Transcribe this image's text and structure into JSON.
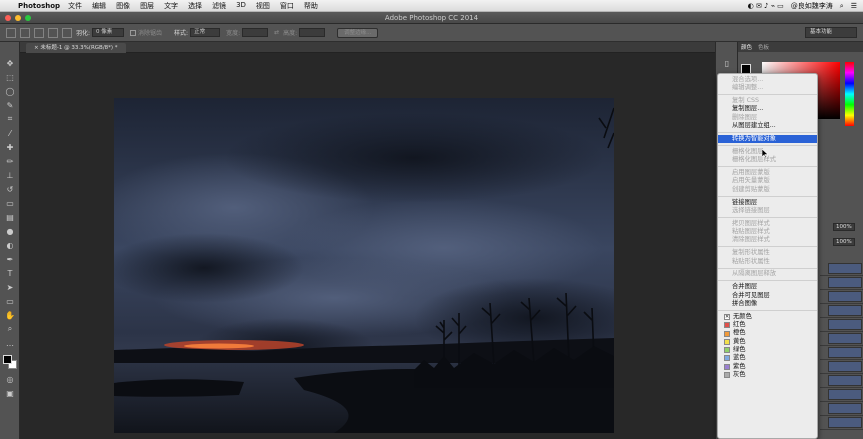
{
  "menubar": {
    "app": "Photoshop",
    "items": [
      "文件",
      "编辑",
      "图像",
      "图层",
      "文字",
      "选择",
      "滤镜",
      "3D",
      "视图",
      "窗口",
      "帮助"
    ],
    "user": "@良如魏李涛"
  },
  "window": {
    "title": "Adobe Photoshop CC 2014"
  },
  "options": {
    "feather_label": "羽化:",
    "feather_value": "0 像素",
    "antialias_label": "消除锯齿",
    "style_label": "样式:",
    "style_value": "正常",
    "width_label": "宽度:",
    "height_label": "高度:",
    "refine_button": "调整边缘...",
    "workspace": "基本功能"
  },
  "document": {
    "tab_label": "未标题-1 @ 33.3%(RGB/8*) *"
  },
  "panels": {
    "color_tab": "颜色",
    "swatches_tab": "色板",
    "opacity_value": "100%",
    "fill_value": "100%"
  },
  "context_menu": {
    "items": [
      {
        "label": "混合选项...",
        "disabled": true,
        "sep": false
      },
      {
        "label": "编辑调整...",
        "disabled": true,
        "sep": true
      },
      {
        "label": "复制 CSS",
        "disabled": true,
        "sep": false
      },
      {
        "label": "复制图层...",
        "disabled": false,
        "sep": false
      },
      {
        "label": "删除图层",
        "disabled": true,
        "sep": false
      },
      {
        "label": "从图层建立组...",
        "disabled": false,
        "sep": true
      },
      {
        "label": "转换为智能对象",
        "disabled": false,
        "highlighted": true,
        "sep": true
      },
      {
        "label": "栅格化图层",
        "disabled": true,
        "sep": false
      },
      {
        "label": "栅格化图层样式",
        "disabled": true,
        "sep": true
      },
      {
        "label": "启用图层蒙版",
        "disabled": true,
        "sep": false
      },
      {
        "label": "启用矢量蒙版",
        "disabled": true,
        "sep": false
      },
      {
        "label": "创建剪贴蒙版",
        "disabled": true,
        "sep": true
      },
      {
        "label": "链接图层",
        "disabled": false,
        "sep": false
      },
      {
        "label": "选择链接图层",
        "disabled": true,
        "sep": true
      },
      {
        "label": "拷贝图层样式",
        "disabled": true,
        "sep": false
      },
      {
        "label": "粘贴图层样式",
        "disabled": true,
        "sep": false
      },
      {
        "label": "清除图层样式",
        "disabled": true,
        "sep": true
      },
      {
        "label": "复制形状属性",
        "disabled": true,
        "sep": false
      },
      {
        "label": "粘贴形状属性",
        "disabled": true,
        "sep": true
      },
      {
        "label": "从隔离图层释放",
        "disabled": true,
        "sep": true
      },
      {
        "label": "合并图层",
        "disabled": false,
        "sep": false
      },
      {
        "label": "合并可见图层",
        "disabled": false,
        "sep": false
      },
      {
        "label": "拼合图像",
        "disabled": false,
        "sep": true
      }
    ],
    "colors": [
      {
        "label": "无颜色",
        "color": "#ffffff",
        "mark": "✕"
      },
      {
        "label": "红色",
        "color": "#e0504a",
        "mark": ""
      },
      {
        "label": "橙色",
        "color": "#f29a3a",
        "mark": ""
      },
      {
        "label": "黄色",
        "color": "#f2e04a",
        "mark": ""
      },
      {
        "label": "绿色",
        "color": "#8fd06a",
        "mark": ""
      },
      {
        "label": "蓝色",
        "color": "#7fa8e0",
        "mark": ""
      },
      {
        "label": "紫色",
        "color": "#9a7fd0",
        "mark": ""
      },
      {
        "label": "灰色",
        "color": "#aaaaaa",
        "mark": ""
      }
    ]
  },
  "colors": {
    "highlight": "#2a62d6",
    "panel_bg": "#535353",
    "canvas_bg": "#282828"
  }
}
